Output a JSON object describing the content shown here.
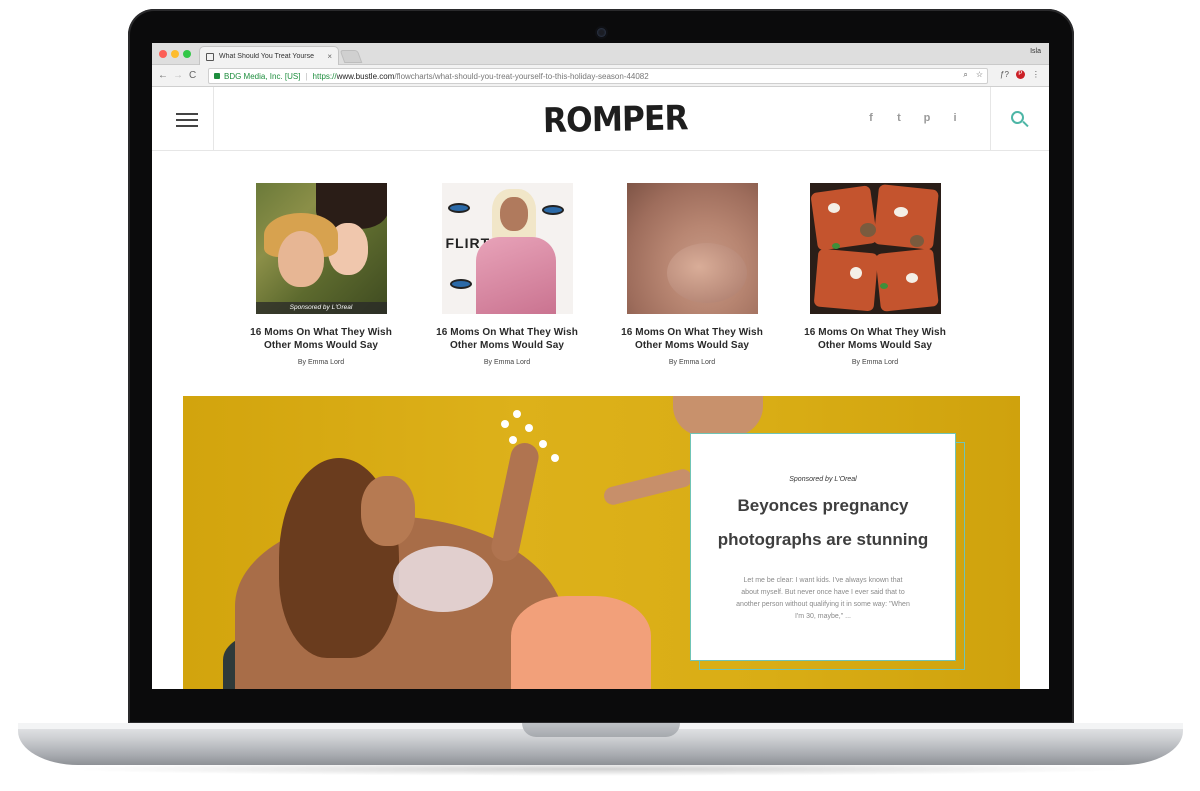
{
  "browser": {
    "tab_title": "What Should You Treat Yourse",
    "tab_close": "×",
    "profile_name": "Isla",
    "nav_back": "←",
    "nav_forward": "→",
    "nav_reload": "C",
    "secure_org": "BDG Media, Inc. [US]",
    "url_scheme": "https://",
    "url_host": "www.bustle.com",
    "url_path": "/flowcharts/what-should-you-treat-yourself-to-this-holiday-season-44082",
    "omnibox_icons": [
      "zoom-icon",
      "star-icon"
    ],
    "extension_icons": [
      "font-icon",
      "pinterest-icon",
      "menu-icon"
    ]
  },
  "site": {
    "logo": "ROMPER",
    "social": [
      "f",
      "t",
      "p",
      "i"
    ]
  },
  "articles": [
    {
      "title": "16 Moms On What They Wish Other Moms Would Say",
      "author": "By Emma Lord",
      "sponsor": "Sponsored by L'Oreal"
    },
    {
      "title": "16 Moms On What They Wish Other Moms Would Say",
      "author": "By Emma Lord"
    },
    {
      "title": "16 Moms On What They Wish Other Moms Would Say",
      "author": "By Emma Lord"
    },
    {
      "title": "16 Moms On What They Wish Other Moms Would Say",
      "author": "By Emma Lord"
    }
  ],
  "thumb2_text": "FLIRT",
  "hero": {
    "sponsor": "Sponsored by L'Oreal",
    "title_line1": "Beyonces pregnancy",
    "title_line2": "photographs are stunning",
    "excerpt": "Let me be clear: I want kids. I've always known that about myself. But never once have I ever said that to another person without qualifying it in some way: \"When I'm 30, maybe,\" ..."
  },
  "colors": {
    "accent": "#4db6a6",
    "hero_background": "#d6a812",
    "secure_green": "#1e8e3e"
  }
}
